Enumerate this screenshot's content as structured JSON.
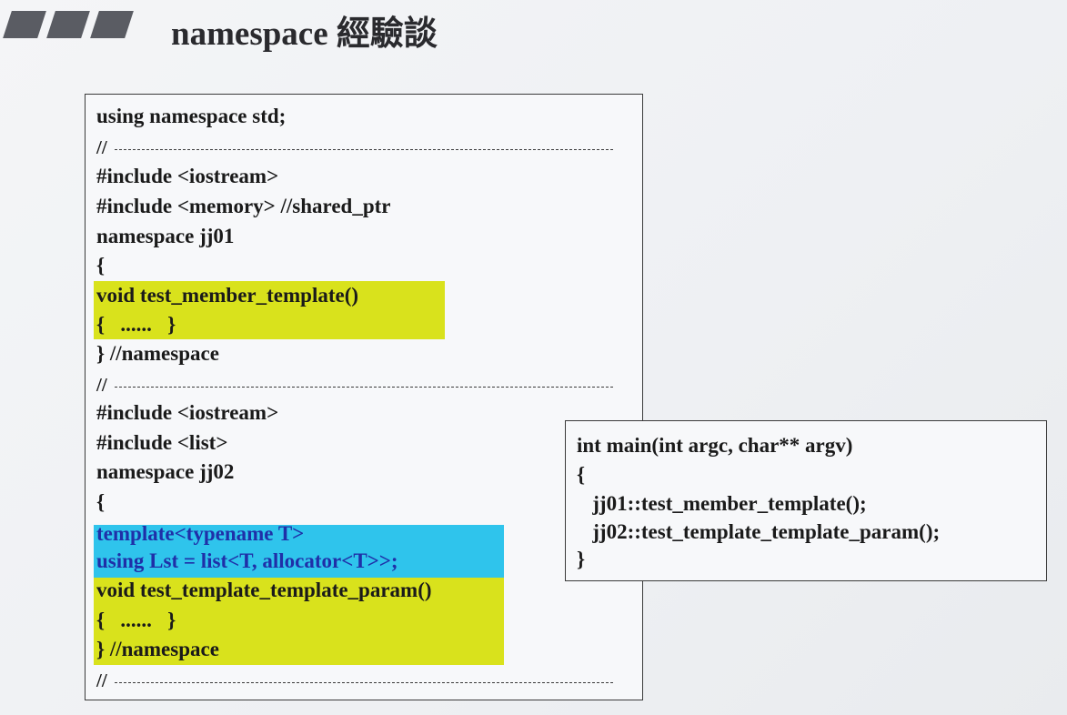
{
  "header": {
    "title": "namespace 經驗談"
  },
  "left_box": {
    "lines": [
      "using namespace std;",
      "//",
      "#include <iostream>",
      "#include <memory> //shared_ptr",
      "namespace jj01",
      "{",
      "void test_member_template()",
      "{   ......   }",
      "} //namespace",
      "//",
      "#include <iostream>",
      "#include <list>",
      "namespace jj02",
      "{",
      "template<typename T>",
      "using Lst = list<T, allocator<T>>;",
      "void test_template_template_param()",
      "{   ......   }",
      "} //namespace",
      "//"
    ]
  },
  "right_box": {
    "lines": [
      "int main(int argc, char** argv)",
      "{",
      "   jj01::test_member_template();",
      "   jj02::test_template_template_param();",
      "}"
    ]
  },
  "colors": {
    "highlight_yellow": "#d9e21c",
    "highlight_cyan": "#2fc4ec",
    "highlight_text_blue": "#1f2fa8"
  }
}
